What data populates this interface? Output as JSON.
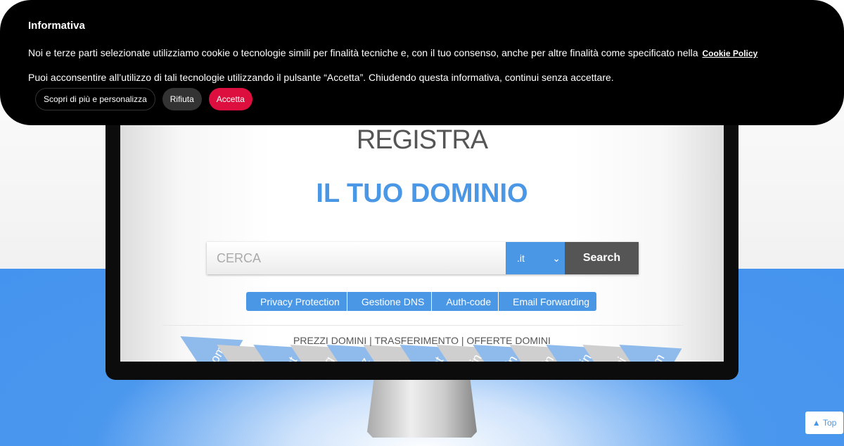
{
  "cookie_banner": {
    "title": "Informativa",
    "text1": "Noi e terze parti selezionate utilizziamo cookie o tecnologie simili per finalità tecniche e, con il tuo consenso, anche per altre finalità come specificato nella",
    "policy_link": "Cookie Policy",
    "text2": "Puoi acconsentire all’utilizzo di tali tecnologie utilizzando il pulsante “Accetta”. Chiudendo questa informativa, continui senza accettare.",
    "buttons": {
      "customize": "Scopri di più e personalizza",
      "reject": "Rifiuta",
      "accept": "Accetta"
    }
  },
  "hero": {
    "title1": "REGISTRA",
    "title2": "IL TUO DOMINIO"
  },
  "search": {
    "placeholder": "CERCA",
    "tld": ".it",
    "button": "Search"
  },
  "options": [
    "Privacy Protection",
    "Gestione DNS",
    "Auth-code",
    "Email Forwarding"
  ],
  "links": [
    "PREZZI DOMINI",
    "TRASFERIMENTO",
    "OFFERTE DOMINI"
  ],
  "tags": [
    "com",
    "in",
    "net",
    "org",
    "biz",
    "in",
    "net",
    "et.in",
    "o.in",
    "d.in",
    "rg.in",
    "obi",
    "com"
  ],
  "top_button": "Top",
  "colors": {
    "accent": "#4a97e6",
    "accept": "#dd0f3e"
  }
}
